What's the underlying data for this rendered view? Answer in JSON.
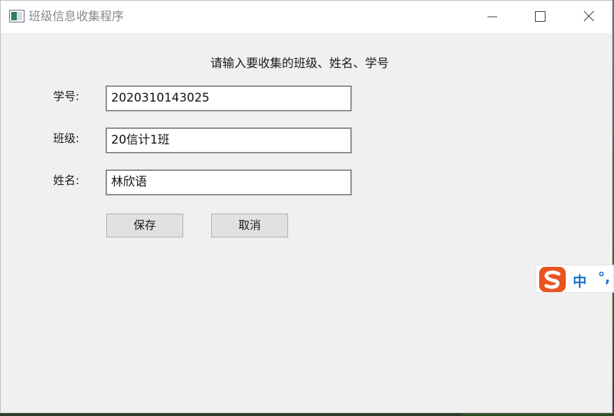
{
  "window": {
    "title": "班级信息收集程序",
    "controls": {
      "minimize": "minimize-icon",
      "maximize": "maximize-icon",
      "close": "close-icon"
    }
  },
  "form": {
    "prompt": "请输入要收集的班级、姓名、学号",
    "fields": [
      {
        "label": "学号:",
        "value": "2020310143025"
      },
      {
        "label": "班级:",
        "value": "20信计1班"
      },
      {
        "label": "姓名:",
        "value": "林欣语"
      }
    ],
    "buttons": {
      "save": "保存",
      "cancel": "取消"
    }
  },
  "ime_bar": {
    "logo": "sogou-s-icon",
    "mode": "中",
    "punctuation": "°,"
  },
  "colors": {
    "window_bg": "#f0f0f0",
    "ime_accent": "#1a72c9",
    "ime_logo": "#e8531f"
  }
}
